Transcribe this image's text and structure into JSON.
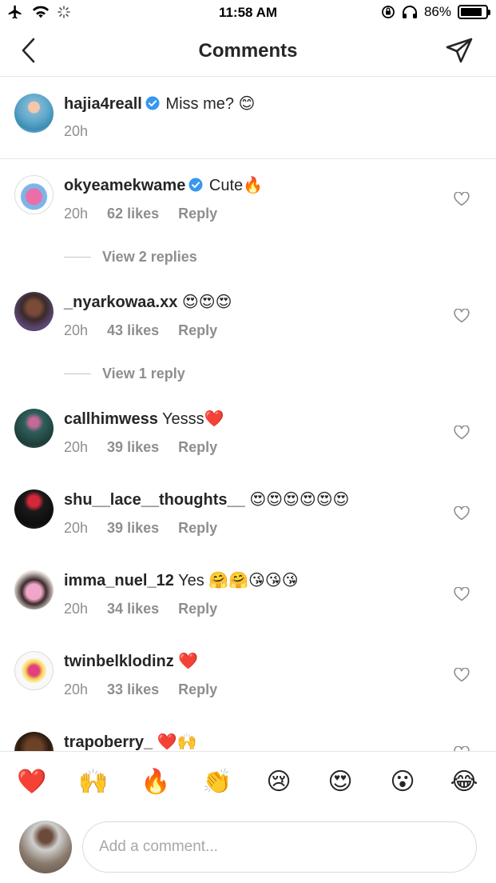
{
  "status_bar": {
    "time": "11:58 AM",
    "battery": "86%",
    "battery_level": 0.86
  },
  "header": {
    "title": "Comments",
    "back_icon": "chevron-left-icon",
    "share_icon": "paper-plane-icon"
  },
  "caption": {
    "username": "hajia4reall",
    "verified": true,
    "text": "Miss me? 😊",
    "time": "20h"
  },
  "comments": [
    {
      "username": "okyeamekwame",
      "verified": true,
      "text": "Cute🔥",
      "time": "20h",
      "likes": "62 likes",
      "reply": "Reply",
      "view_replies": "View 2 replies"
    },
    {
      "username": "_nyarkowaa.xx",
      "verified": false,
      "text": "😍😍😍",
      "time": "20h",
      "likes": "43 likes",
      "reply": "Reply",
      "view_replies": "View 1 reply"
    },
    {
      "username": "callhimwess",
      "verified": false,
      "text": "Yesss❤️",
      "time": "20h",
      "likes": "39 likes",
      "reply": "Reply"
    },
    {
      "username": "shu__lace__thoughts__",
      "verified": false,
      "text": "😍😍😍😍😍😍",
      "time": "20h",
      "likes": "39 likes",
      "reply": "Reply"
    },
    {
      "username": "imma_nuel_12",
      "verified": false,
      "text": "Yes 🤗🤗😘😘😘",
      "time": "20h",
      "likes": "34 likes",
      "reply": "Reply"
    },
    {
      "username": "twinbelklodinz",
      "verified": false,
      "text": "❤️",
      "time": "20h",
      "likes": "33 likes",
      "reply": "Reply"
    },
    {
      "username": "trapoberry_",
      "verified": false,
      "text": "❤️🙌",
      "time": "",
      "likes": "",
      "reply": ""
    }
  ],
  "quick_emojis": [
    "❤️",
    "🙌",
    "🔥",
    "👏",
    "😢",
    "😍",
    "😮",
    "😂"
  ],
  "composer": {
    "placeholder": "Add a comment..."
  }
}
